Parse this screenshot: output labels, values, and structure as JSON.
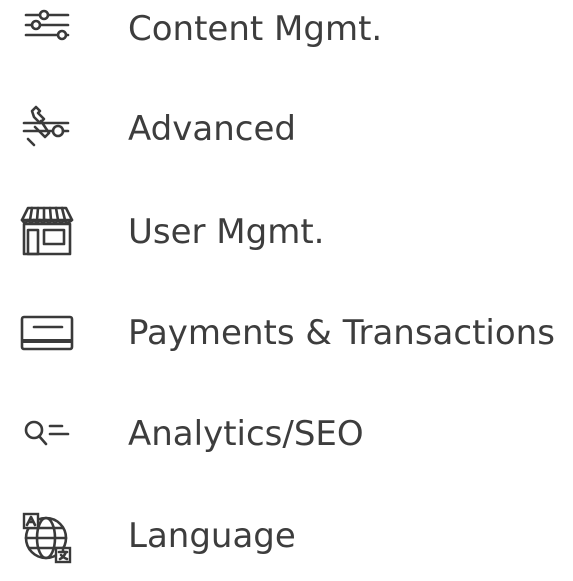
{
  "menu": {
    "items": [
      {
        "label": "Content Mgmt.",
        "icon": "sliders-icon"
      },
      {
        "label": "Advanced",
        "icon": "wrench-settings-icon"
      },
      {
        "label": "User Mgmt.",
        "icon": "storefront-icon"
      },
      {
        "label": "Payments & Transactions",
        "icon": "credit-card-icon"
      },
      {
        "label": "Analytics/SEO",
        "icon": "search-list-icon"
      },
      {
        "label": "Language",
        "icon": "globe-translate-icon"
      }
    ]
  }
}
